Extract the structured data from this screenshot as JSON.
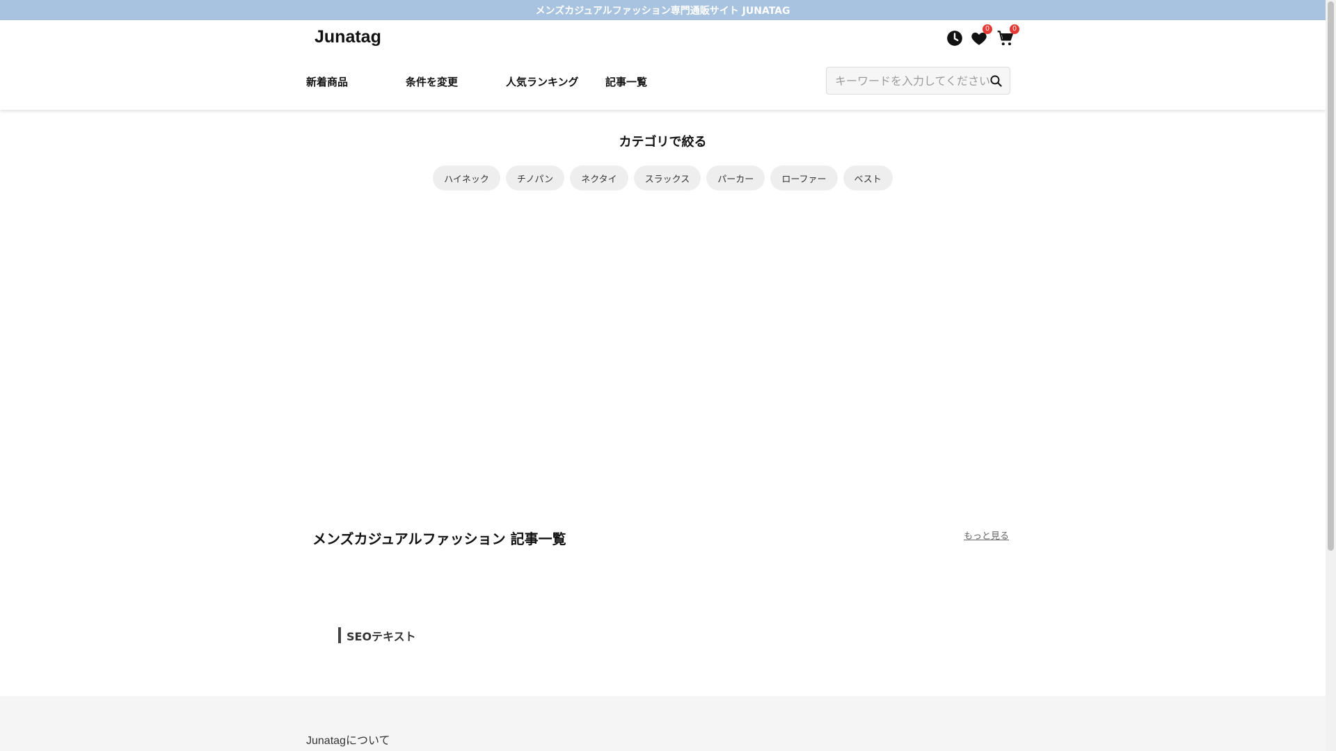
{
  "topbar": {
    "text": "メンズカジュアルファッション専門通販サイト JUNATAG"
  },
  "header": {
    "logo": "Junatag",
    "history_icon": "clock-icon",
    "favorites_icon": "heart-icon",
    "favorites_count": "0",
    "cart_icon": "cart-icon",
    "cart_count": "0"
  },
  "nav": {
    "items": [
      {
        "label": "新着商品"
      },
      {
        "label": "条件を変更"
      },
      {
        "label": "人気ランキング"
      },
      {
        "label": "記事一覧"
      }
    ]
  },
  "search": {
    "placeholder": "キーワードを入力してください",
    "value": "",
    "icon": "search-icon"
  },
  "category": {
    "title": "カテゴリで絞る",
    "chips": [
      "ハイネック",
      "チノパン",
      "ネクタイ",
      "スラックス",
      "パーカー",
      "ローファー",
      "ベスト"
    ]
  },
  "articles": {
    "title": "メンズカジュアルファッション 記事一覧",
    "more_label": "もっと見る"
  },
  "seo": {
    "label": "SEOテキスト"
  },
  "footer": {
    "about": "Junatagについて"
  },
  "colors": {
    "topbar": "#a8c3df",
    "badge": "#e53935",
    "chip": "#eeeeee",
    "footer": "#f5f5f5"
  }
}
